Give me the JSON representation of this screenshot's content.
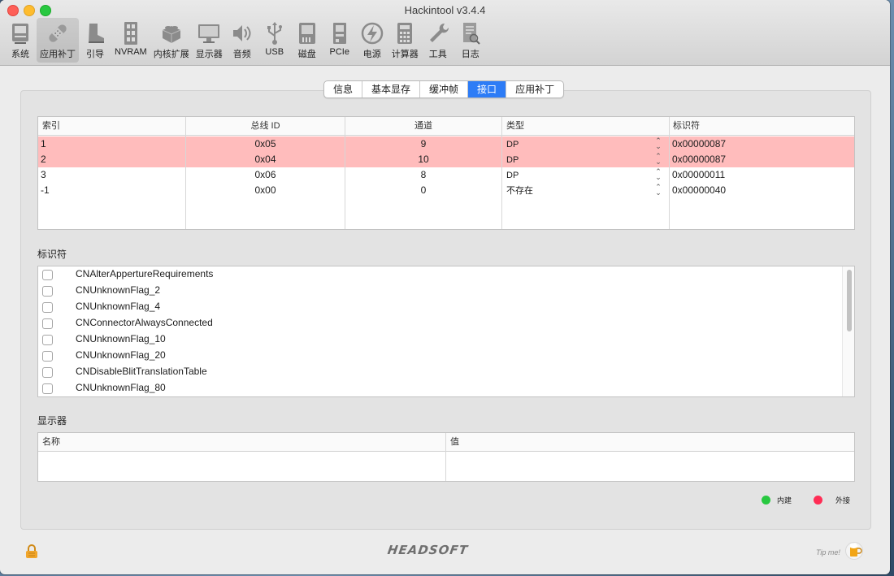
{
  "window": {
    "title": "Hackintool v3.4.4"
  },
  "toolbar": {
    "items": [
      {
        "label": "系统",
        "icon": "computer-icon"
      },
      {
        "label": "应用补丁",
        "icon": "bandage-icon",
        "active": true
      },
      {
        "label": "引导",
        "icon": "boot-icon"
      },
      {
        "label": "NVRAM",
        "icon": "memory-chip-icon"
      },
      {
        "label": "内核扩展",
        "icon": "lego-brick-icon"
      },
      {
        "label": "显示器",
        "icon": "monitor-icon"
      },
      {
        "label": "音频",
        "icon": "speaker-icon"
      },
      {
        "label": "USB",
        "icon": "usb-icon"
      },
      {
        "label": "磁盘",
        "icon": "sd-card-icon"
      },
      {
        "label": "PCIe",
        "icon": "pcie-card-icon"
      },
      {
        "label": "电源",
        "icon": "power-bolt-icon"
      },
      {
        "label": "计算器",
        "icon": "calculator-icon"
      },
      {
        "label": "工具",
        "icon": "wrench-icon"
      },
      {
        "label": "日志",
        "icon": "log-icon"
      }
    ]
  },
  "tabs": [
    {
      "label": "信息"
    },
    {
      "label": "基本显存"
    },
    {
      "label": "缓冲帧"
    },
    {
      "label": "接口",
      "active": true
    },
    {
      "label": "应用补丁"
    }
  ],
  "connectors": {
    "headers": {
      "index": "索引",
      "bus_id": "总线 ID",
      "pipe": "通道",
      "type": "类型",
      "flags": "标识符"
    },
    "rows": [
      {
        "index": "1",
        "bus_id": "0x05",
        "pipe": "9",
        "type": "DP",
        "flags": "0x00000087",
        "highlight": true
      },
      {
        "index": "2",
        "bus_id": "0x04",
        "pipe": "10",
        "type": "DP",
        "flags": "0x00000087",
        "highlight": true
      },
      {
        "index": "3",
        "bus_id": "0x06",
        "pipe": "8",
        "type": "DP",
        "flags": "0x00000011",
        "highlight": false
      },
      {
        "index": "-1",
        "bus_id": "0x00",
        "pipe": "0",
        "type": "不存在",
        "flags": "0x00000040",
        "highlight": false
      }
    ]
  },
  "flags_section": {
    "title": "标识符",
    "items": [
      {
        "label": "CNAlterAppertureRequirements",
        "checked": false
      },
      {
        "label": "CNUnknownFlag_2",
        "checked": false
      },
      {
        "label": "CNUnknownFlag_4",
        "checked": false
      },
      {
        "label": "CNConnectorAlwaysConnected",
        "checked": false
      },
      {
        "label": "CNUnknownFlag_10",
        "checked": false
      },
      {
        "label": "CNUnknownFlag_20",
        "checked": false
      },
      {
        "label": "CNDisableBlitTranslationTable",
        "checked": false
      },
      {
        "label": "CNUnknownFlag_80",
        "checked": false
      }
    ]
  },
  "display_section": {
    "title": "显示器",
    "headers": {
      "name": "名称",
      "value": "值"
    }
  },
  "legend": {
    "internal": {
      "label": "内建",
      "color": "#28c840"
    },
    "external": {
      "label": "外接",
      "color": "#ff2d55"
    }
  },
  "footer": {
    "brand": "HEADSOFT",
    "tip": "Tip me!"
  },
  "colors": {
    "accent": "#2d7cf6",
    "highlight_row": "#ffbcbc"
  }
}
